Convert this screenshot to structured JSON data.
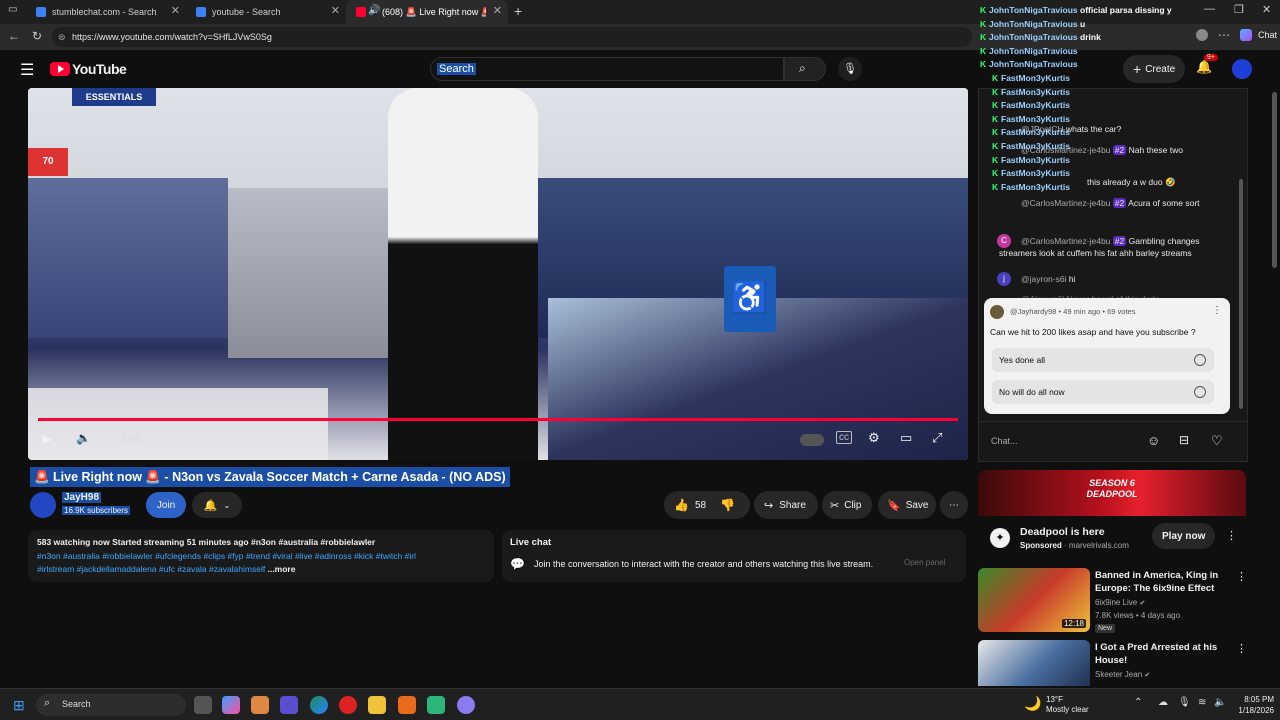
{
  "browser": {
    "tabs": [
      {
        "label": "stumblechat.com - Search"
      },
      {
        "label": "youtube - Search"
      },
      {
        "label": "(608) 🚨 Live Right now 🚨 -"
      }
    ],
    "url": "https://www.youtube.com/watch?v=SHfLJVwS0Sg",
    "chat_label": "Chat"
  },
  "yt": {
    "logo": "YouTube",
    "search_value": "Search",
    "create_label": "Create",
    "notif_count": "9+"
  },
  "video": {
    "title": "🚨 Live Right now 🚨 - N3on vs Zavala Soccer Match + Carne Asada - (NO ADS)",
    "live_label": "Live",
    "progress": 1.0,
    "store_sign": "ESSENTIALS",
    "price_sign": "70"
  },
  "channel": {
    "name": "JayH98",
    "subs": "16.9K subscribers",
    "join_label": "Join"
  },
  "actions": {
    "likes": "58",
    "share": "Share",
    "clip": "Clip",
    "save": "Save"
  },
  "description": {
    "line1": "583 watching now  Started streaming 51 minutes ago  #n3on #australia #robbielawler",
    "line2": "#n3on #australia  #robbielawler #ufclegends #clips  #fyp #trend #viral #live  #adinross #kick #twitch #irl",
    "line3": "#irlstream #jackdellamaddalena  #ufc #zavala #zavalahimself",
    "more": "...more"
  },
  "live_chat_box": {
    "heading": "Live chat",
    "text": "Join the conversation to interact with the creator and others watching this live stream.",
    "open_panel": "Open panel"
  },
  "chat": {
    "overlay": [
      {
        "user": "JohnTonNigaTravious",
        "text": "official parsa dissing y"
      },
      {
        "user": "JohnTonNigaTravious",
        "text": "u"
      },
      {
        "user": "JohnTonNigaTravious",
        "text": "drink"
      },
      {
        "user": "JohnTonNigaTravious",
        "text": ""
      },
      {
        "user": "JohnTonNigaTravious",
        "text": ""
      },
      {
        "user": "FastMon3yKurtis",
        "text": ""
      },
      {
        "user": "FastMon3yKurtis",
        "text": ""
      },
      {
        "user": "FastMon3yKurtis",
        "text": ""
      },
      {
        "user": "FastMon3yKurtis",
        "text": ""
      },
      {
        "user": "FastMon3yKurtis",
        "text": ""
      },
      {
        "user": "FastMon3yKurtis",
        "text": ""
      },
      {
        "user": "FastMon3yKurtis",
        "text": ""
      },
      {
        "user": "FastMon3yKurtis",
        "text": ""
      },
      {
        "user": "FastMon3yKurtis",
        "text": ""
      }
    ],
    "messages": [
      {
        "user": "@JPnotCH",
        "text": "whats the car?"
      },
      {
        "user": "@CarlosMartinez-je4bu",
        "badge": "#2",
        "text": "Nah these two"
      },
      {
        "user": "",
        "text": "this already a w duo 🤣"
      },
      {
        "user": "@CarlosMartinez-je4bu",
        "badge": "#2",
        "text": "Acura of some sort"
      },
      {
        "user": "@CarlosMartinez-je4bu",
        "badge": "#2",
        "text": "Gambling changes streamers look at cuffem his fat ahh barley streams"
      },
      {
        "user": "@jayron-s6i",
        "text": "hi"
      },
      {
        "user": "@Alex-xs6l",
        "text": "Never heard of this dude"
      }
    ],
    "input_placeholder": "Chat..."
  },
  "poll": {
    "author": "@Jayhardy98",
    "meta": "• 49 min ago • 69 votes",
    "question": "Can we hit to 200 likes asap and have you subscribe ?",
    "options": [
      "Yes done all",
      "No will do all now"
    ]
  },
  "ad": {
    "banner_text": "SEASON 6 DEADPOOL",
    "title": "Deadpool is here",
    "sponsored": "Sponsored",
    "source": "· marvelrivals.com",
    "cta": "Play now"
  },
  "related": [
    {
      "title": "Banned in America, King in Europe: The 6ix9ine Effect",
      "channel": "6ix9ine Live",
      "meta": "7.8K views • 4 days ago",
      "badge": "New",
      "duration": "12:18"
    },
    {
      "title": "I Got a Pred Arrested at his House!",
      "channel": "Skeeter Jean",
      "meta": "",
      "badge": "",
      "duration": ""
    }
  ],
  "taskbar": {
    "search": "Search",
    "weather_temp": "13°F",
    "weather_text": "Mostly clear",
    "time": "8:05 PM",
    "date": "1/18/2026"
  },
  "colors": {
    "yt_red": "#ff0033",
    "title_highlight": "#1b4fa5",
    "chat_green": "#2dff6e"
  }
}
